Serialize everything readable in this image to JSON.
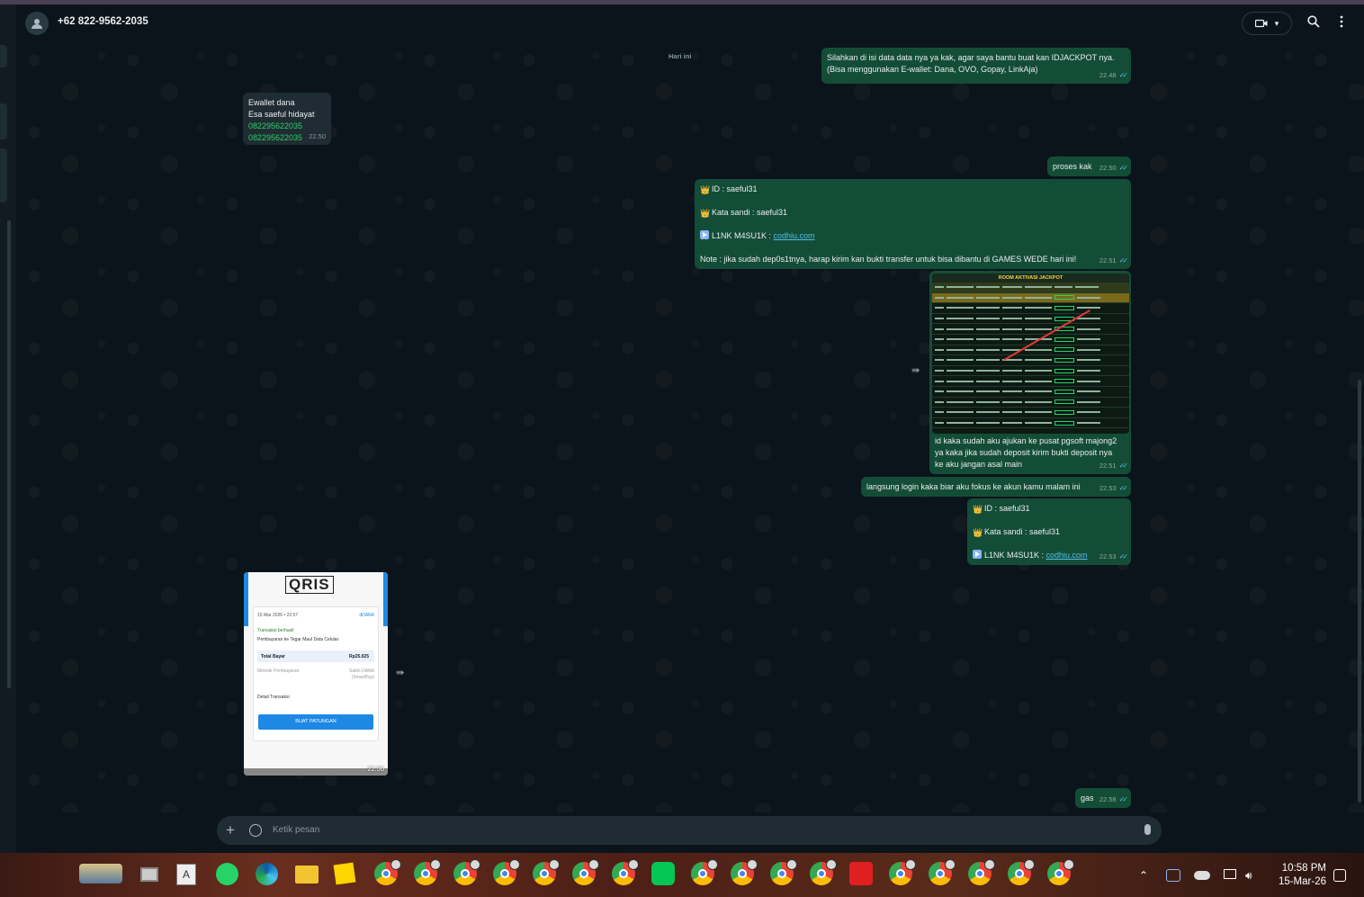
{
  "header": {
    "contact": "+62 822-9562-2035"
  },
  "chat": {
    "date_chip": "Hari ini",
    "messages": [
      {
        "id": "m1",
        "dir": "out",
        "lines": [
          "Silahkan di isi data data nya ya kak, agar saya bantu buat kan IDJACKPOT nya.",
          "(Bisa menggunakan E-wallet: Dana, OVO, Gopay, LinkAja)"
        ],
        "time": "22.48"
      },
      {
        "id": "m2",
        "dir": "in",
        "lines": [
          "Ewallet dana",
          "Esa saeful hidayat"
        ],
        "phones": [
          "082295622035",
          "082295622035"
        ],
        "time": "22.50"
      },
      {
        "id": "m3",
        "dir": "out",
        "lines": [
          "proses kak"
        ],
        "time": "22.50"
      },
      {
        "id": "m4",
        "dir": "out",
        "id_line": "ID :  saeful31",
        "pass_line": "Kata sandi : saeful31",
        "link_prefix": "L1NK M4SU1K : ",
        "link": "codhiu.com",
        "note": "Note : jika sudah dep0s1tnya, harap kirim kan bukti transfer untuk bisa dibantu di GAMES WEDE hari ini!",
        "time": "22.51"
      },
      {
        "id": "m5",
        "dir": "out",
        "image_title": "ROOM AKTIVASI JACKPOT",
        "caption": [
          "id kaka sudah aku ajukan ke pusat pgsoft majong2",
          "ya kaka jika sudah deposit kirim bukti deposit nya",
          "ke aku jangan asal main"
        ],
        "time": "22.51"
      },
      {
        "id": "m6",
        "dir": "out",
        "lines": [
          "langsung login kaka biar aku fokus ke akun kamu malam ini"
        ],
        "time": "22.53"
      },
      {
        "id": "m7",
        "dir": "out",
        "id_line": "ID :  saeful31",
        "pass_line": "Kata sandi : saeful31",
        "link_prefix": "L1NK M4SU1K : ",
        "link": "codhiu.com",
        "time": "22.53"
      },
      {
        "id": "m8",
        "dir": "in",
        "image": "qris-receipt",
        "time": "22.56"
      },
      {
        "id": "m9",
        "dir": "out",
        "lines": [
          "gas"
        ],
        "time": "22.58"
      }
    ],
    "qris": {
      "logo": "QRIS",
      "date": "15 Mar 2026 • 22:57",
      "wallet": "dDANA",
      "status": "Transaksi berhasil",
      "desc": "Pembayaran ke Tegar Maul Data Celular",
      "total_label": "Total Bayar",
      "total": "Rp25.025",
      "method_label": "Metode Pembayaran",
      "method": "Saldo DANA",
      "method2": "(SmartPay)",
      "detail": "Detail Transaksi",
      "button": "BUAT PATUNGAN"
    }
  },
  "compose": {
    "placeholder": "Ketik pesan"
  },
  "taskbar": {
    "time": "10:58 PM",
    "date": "15-Mar-26"
  }
}
